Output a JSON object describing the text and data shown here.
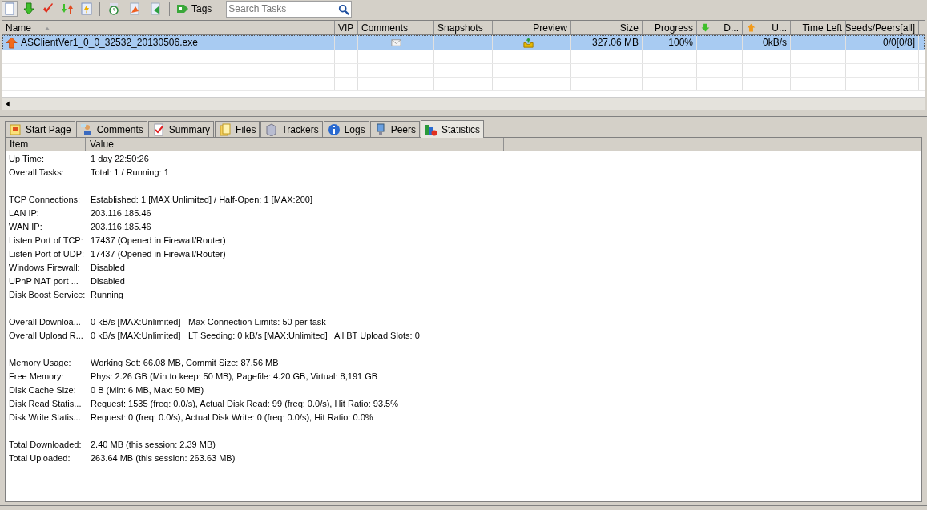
{
  "toolbar": {
    "tags_label": "Tags",
    "search": {
      "placeholder": "Search Tasks"
    }
  },
  "task_table": {
    "columns": [
      {
        "label": "Name",
        "kind": "sorted"
      },
      {
        "label": "VIP",
        "kind": "plain"
      },
      {
        "label": "Comments",
        "kind": "plain"
      },
      {
        "label": "Snapshots",
        "kind": "plain"
      },
      {
        "label": "Preview",
        "kind": "right"
      },
      {
        "label": "Size",
        "kind": "right"
      },
      {
        "label": "Progress",
        "kind": "right"
      },
      {
        "label": "D...",
        "kind": "down"
      },
      {
        "label": "U...",
        "kind": "up"
      },
      {
        "label": "Time Left",
        "kind": "right"
      },
      {
        "label": "Seeds/Peers[all]",
        "kind": "right"
      }
    ],
    "rows": [
      {
        "selected": true,
        "name": "ASClientVer1_0_0_32532_20130506.exe",
        "size": "327.06 MB",
        "progress": "100%",
        "upload_speed": "0kB/s",
        "seeds_peers": "0/0[0/8]"
      }
    ]
  },
  "tabs": [
    {
      "label": "Start Page",
      "selected": false
    },
    {
      "label": "Comments",
      "selected": false
    },
    {
      "label": "Summary",
      "selected": false
    },
    {
      "label": "Files",
      "selected": false
    },
    {
      "label": "Trackers",
      "selected": false
    },
    {
      "label": "Logs",
      "selected": false
    },
    {
      "label": "Peers",
      "selected": false
    },
    {
      "label": "Statistics",
      "selected": true
    }
  ],
  "statistics": {
    "columns": [
      "Item",
      "Value"
    ],
    "groups": [
      [
        {
          "item": "Up Time:",
          "values": [
            "1 day 22:50:26"
          ]
        },
        {
          "item": "Overall Tasks:",
          "values": [
            "Total: 1 / Running: 1"
          ]
        }
      ],
      [
        {
          "item": "TCP Connections:",
          "values": [
            "Established: 1 [MAX:Unlimited] / Half-Open: 1 [MAX:200]"
          ]
        },
        {
          "item": "LAN IP:",
          "values": [
            "203.116.185.46"
          ]
        },
        {
          "item": "WAN IP:",
          "values": [
            "203.116.185.46"
          ]
        },
        {
          "item": "Listen Port of TCP:",
          "values": [
            "17437 (Opened in Firewall/Router)"
          ]
        },
        {
          "item": "Listen Port of UDP:",
          "values": [
            "17437 (Opened in Firewall/Router)"
          ]
        },
        {
          "item": "Windows Firewall:",
          "values": [
            "Disabled"
          ]
        },
        {
          "item": "UPnP NAT port ...",
          "values": [
            "Disabled"
          ]
        },
        {
          "item": "Disk Boost Service:",
          "values": [
            "Running"
          ]
        }
      ],
      [
        {
          "item": "Overall Downloa...",
          "values": [
            "0 kB/s [MAX:Unlimited]",
            "Max Connection Limits: 50 per task"
          ]
        },
        {
          "item": "Overall Upload R...",
          "values": [
            "0 kB/s [MAX:Unlimited]",
            "LT Seeding: 0 kB/s [MAX:Unlimited]",
            "All BT Upload Slots: 0"
          ]
        }
      ],
      [
        {
          "item": "Memory Usage:",
          "values": [
            "Working Set: 66.08 MB, Commit Size: 87.56 MB"
          ]
        },
        {
          "item": "Free Memory:",
          "values": [
            "Phys: 2.26 GB (Min to keep: 50 MB), Pagefile: 4.20 GB, Virtual: 8,191 GB"
          ]
        },
        {
          "item": "Disk Cache Size:",
          "values": [
            "0 B (Min: 6 MB, Max: 50 MB)"
          ]
        },
        {
          "item": "Disk Read Statis...",
          "values": [
            "Request: 1535 (freq: 0.0/s), Actual Disk Read: 99 (freq: 0.0/s), Hit Ratio: 93.5%"
          ]
        },
        {
          "item": "Disk Write Statis...",
          "values": [
            "Request: 0 (freq: 0.0/s), Actual Disk Write: 0 (freq: 0.0/s), Hit Ratio: 0.0%"
          ]
        }
      ],
      [
        {
          "item": "Total Downloaded:",
          "values": [
            "2.40 MB (this session: 2.39 MB)"
          ]
        },
        {
          "item": "Total Uploaded:",
          "values": [
            "263.64 MB (this session: 263.63 MB)"
          ]
        }
      ]
    ]
  }
}
